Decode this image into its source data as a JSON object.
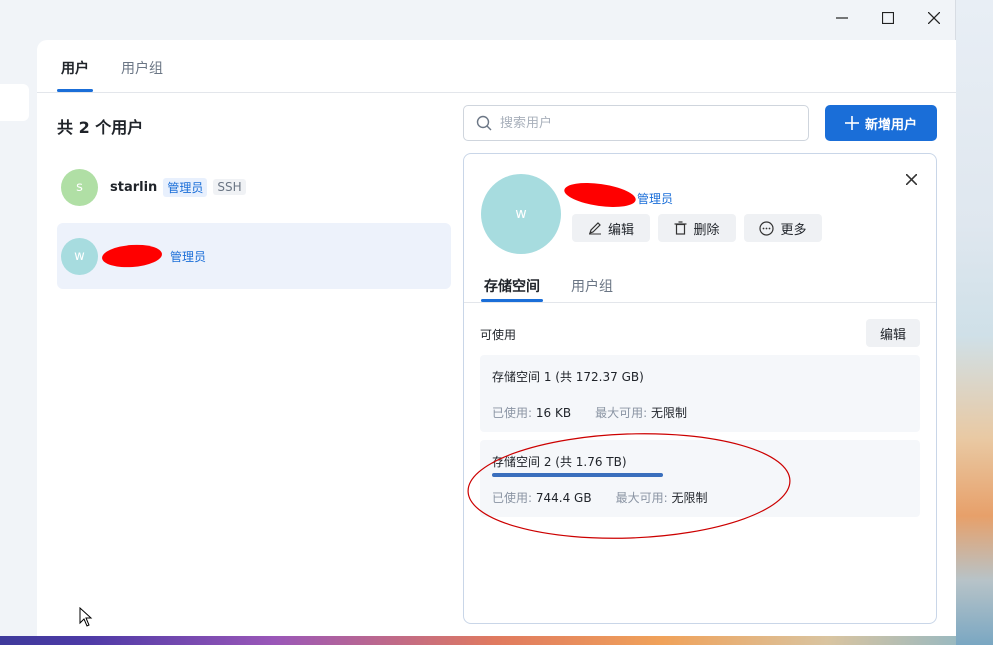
{
  "window_controls": {
    "minimize": "—",
    "maximize": "☐",
    "close": "✕"
  },
  "tabs": [
    {
      "label": "用户",
      "active": true
    },
    {
      "label": "用户组",
      "active": false
    }
  ],
  "user_count": "共 2 个用户",
  "users": [
    {
      "initial": "s",
      "name": "starlin",
      "badges": [
        "管理员",
        "SSH"
      ],
      "avatar_color": "#b0dfa5"
    },
    {
      "initial": "w",
      "name": "",
      "badges": [
        "管理员"
      ],
      "avatar_color": "#a7dcdf",
      "selected": true
    }
  ],
  "search": {
    "placeholder": "搜索用户"
  },
  "add_button": {
    "label": "新增用户"
  },
  "detail": {
    "initial": "w",
    "role_badge": "管理员",
    "actions": {
      "edit": "编辑",
      "delete": "删除",
      "more": "更多"
    },
    "sub_tabs": [
      {
        "label": "存储空间",
        "active": true
      },
      {
        "label": "用户组",
        "active": false
      }
    ],
    "available_label": "可使用",
    "edit_button": "编辑",
    "volumes": [
      {
        "title": "存储空间 1 (共 172.37 GB)",
        "used_label": "已使用:",
        "used": "16 KB",
        "max_label": "最大可用:",
        "max": "无限制",
        "usage_fraction": 0.0
      },
      {
        "title": "存储空间 2 (共 1.76 TB)",
        "used_label": "已使用:",
        "used": "744.4 GB",
        "max_label": "最大可用:",
        "max": "无限制",
        "usage_fraction": 0.41
      }
    ]
  },
  "colors": {
    "accent": "#1a6ed8",
    "annotation": "#cc0000",
    "redaction": "#ff0000"
  }
}
